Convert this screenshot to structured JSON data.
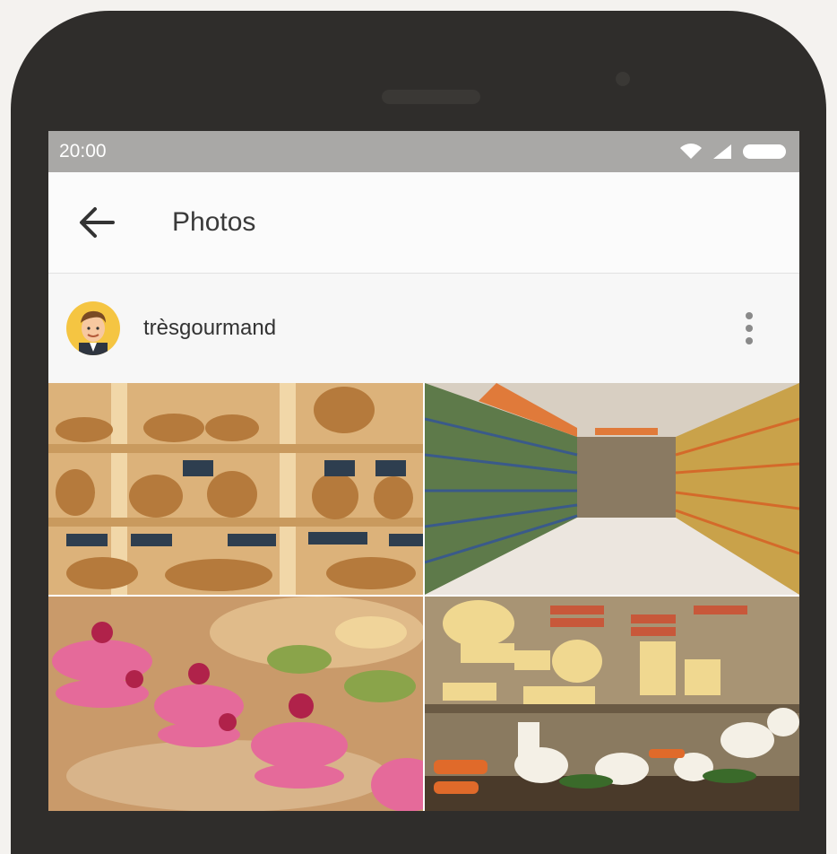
{
  "status_bar": {
    "time": "20:00"
  },
  "app_bar": {
    "title": "Photos",
    "back_icon": "arrow-left-icon"
  },
  "post": {
    "username": "trèsgourmand",
    "more_icon": "more-vertical-icon"
  },
  "photos": [
    {
      "subject": "bakery-bread-shelves"
    },
    {
      "subject": "supermarket-aisle"
    },
    {
      "subject": "pastry-macarons"
    },
    {
      "subject": "cheese-counter"
    }
  ],
  "colors": {
    "status_bar": "#a9a8a6",
    "avatar_bg": "#f5c542"
  }
}
